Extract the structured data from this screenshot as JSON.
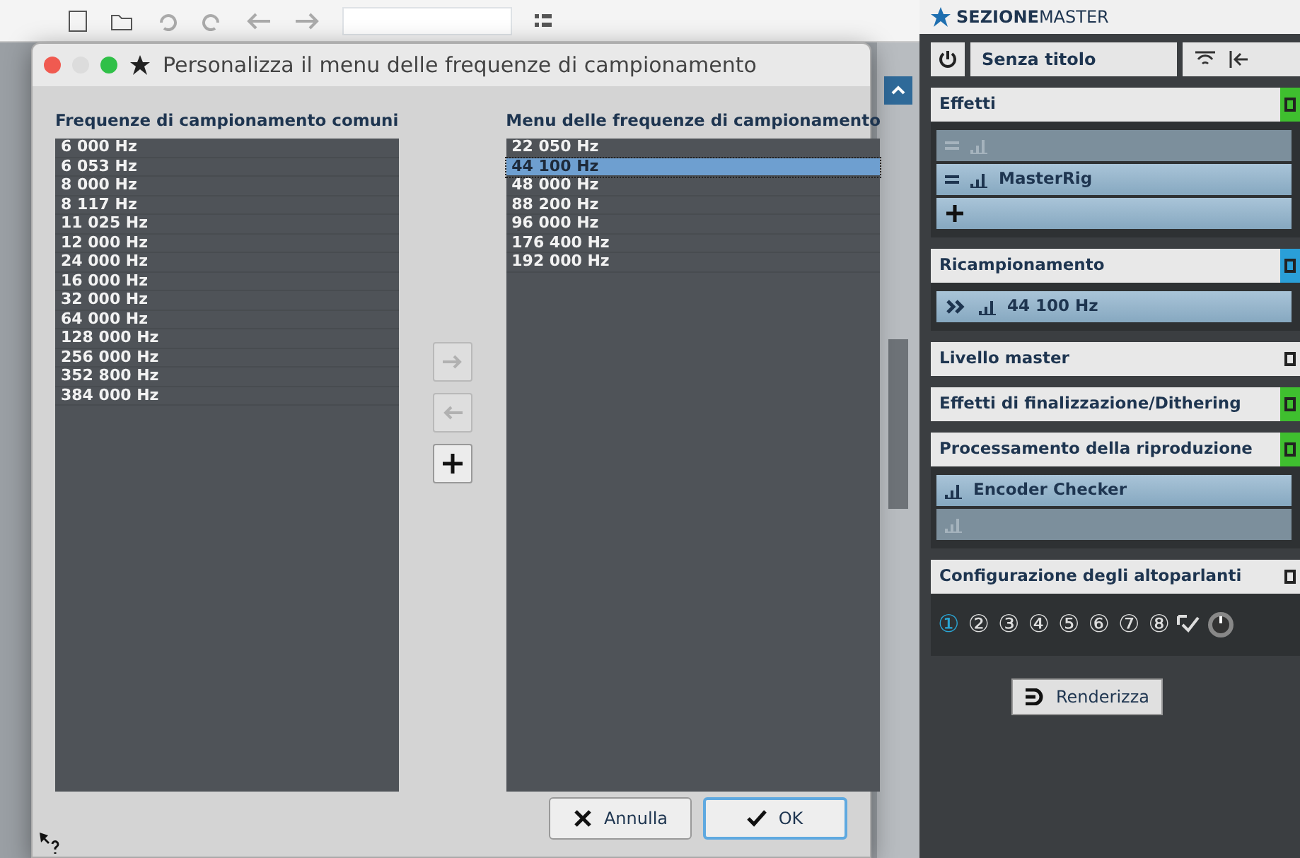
{
  "dialog": {
    "title": "Personalizza il menu delle frequenze di campionamento",
    "common_list": {
      "heading": "Frequenze di campionamento comuni",
      "items": [
        {
          "label": "6 000 Hz",
          "selected": false
        },
        {
          "label": "6 053 Hz",
          "selected": false
        },
        {
          "label": "8 000 Hz",
          "selected": false
        },
        {
          "label": "8 117 Hz",
          "selected": false
        },
        {
          "label": "11 025 Hz",
          "selected": false
        },
        {
          "label": "12 000 Hz",
          "selected": false
        },
        {
          "label": "24 000 Hz",
          "selected": false
        },
        {
          "label": "16 000 Hz",
          "selected": false
        },
        {
          "label": "32 000 Hz",
          "selected": false
        },
        {
          "label": "64 000 Hz",
          "selected": false
        },
        {
          "label": "128 000 Hz",
          "selected": false
        },
        {
          "label": "256 000 Hz",
          "selected": false
        },
        {
          "label": "352 800 Hz",
          "selected": false
        },
        {
          "label": "384 000 Hz",
          "selected": false
        }
      ]
    },
    "menu_list": {
      "heading": "Menu delle frequenze di campionamento",
      "items": [
        {
          "label": "22 050 Hz",
          "selected": false
        },
        {
          "label": "44 100 Hz",
          "selected": true
        },
        {
          "label": "48 000 Hz",
          "selected": false
        },
        {
          "label": "88 200 Hz",
          "selected": false
        },
        {
          "label": "96 000 Hz",
          "selected": false
        },
        {
          "label": "176 400 Hz",
          "selected": false
        },
        {
          "label": "192 000 Hz",
          "selected": false
        }
      ]
    },
    "side_buttons": [
      {
        "kind": "right",
        "disabled": true
      },
      {
        "kind": "left",
        "disabled": true
      },
      {
        "kind": "add",
        "disabled": false
      }
    ],
    "buttons": [
      {
        "label": "Annulla",
        "kind": "cancel"
      },
      {
        "label": "OK",
        "kind": "ok"
      }
    ]
  },
  "master": {
    "title_bold": "SEZIONE",
    "title_light": "MASTER",
    "preset": "Senza titolo",
    "sections": [
      {
        "title": "Effetti",
        "color": "#3fbf2f",
        "slots": [
          {
            "active": false,
            "kind": "effect"
          },
          {
            "label": "MasterRig",
            "active": true,
            "kind": "effect"
          },
          {
            "active": true,
            "kind": "add"
          }
        ]
      },
      {
        "title": "Ricampionamento",
        "color": "#2a9fd8",
        "slots": [
          {
            "label": "44 100 Hz",
            "active": true,
            "kind": "resample"
          }
        ]
      },
      {
        "title": "Livello master",
        "color": "#e6e6e6"
      },
      {
        "title": "Effetti di finalizzazione/Dithering",
        "color": "#3fbf2f"
      },
      {
        "title": "Processamento della riproduzione",
        "color": "#3fbf2f",
        "slots": [
          {
            "label": "Encoder Checker",
            "active": true,
            "kind": "plugin"
          },
          {
            "active": false,
            "kind": "plugin"
          }
        ]
      },
      {
        "title": "Configurazione degli altoparlanti",
        "color": "#e6e6e6"
      }
    ],
    "speakers": [
      {
        "label": "①",
        "selected": true
      },
      {
        "label": "②",
        "selected": false
      },
      {
        "label": "③",
        "selected": false
      },
      {
        "label": "④",
        "selected": false
      },
      {
        "label": "⑤",
        "selected": false
      },
      {
        "label": "⑥",
        "selected": false
      },
      {
        "label": "⑦",
        "selected": false
      },
      {
        "label": "⑧",
        "selected": false
      }
    ],
    "render": "Renderizza"
  }
}
